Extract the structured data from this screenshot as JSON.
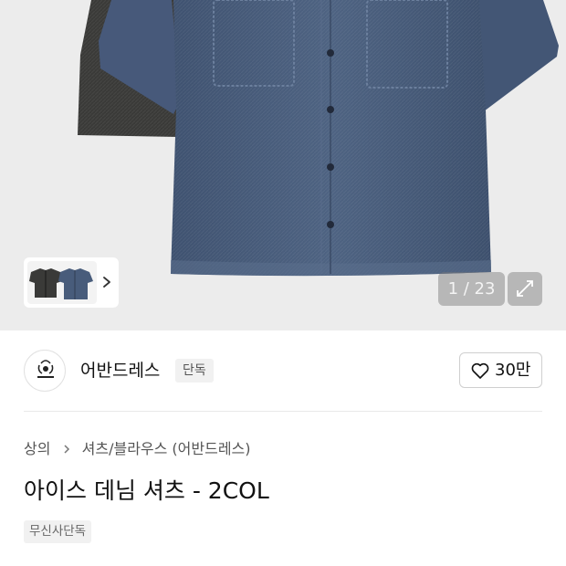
{
  "gallery": {
    "counter": "1 / 23",
    "thumbnail_icon": "shirt-thumbnail",
    "next_icon": "chevron-right-icon",
    "expand_icon": "expand-icon"
  },
  "brand": {
    "name": "어반드레스",
    "exclusive_label": "단독",
    "logo_icon": "brand-logo-icon",
    "likes": "30만",
    "like_icon": "heart-icon"
  },
  "breadcrumb": {
    "items": [
      "상의",
      "셔츠/블라우스 (어반드레스)"
    ],
    "separator_icon": "chevron-right-icon"
  },
  "product": {
    "title": "아이스 데님 셔츠 - 2COL",
    "badge": "무신사단독"
  },
  "colors": {
    "denim": "#4a5d79",
    "dark_shirt": "#3a3a38",
    "hero_bg": "#ececec"
  }
}
